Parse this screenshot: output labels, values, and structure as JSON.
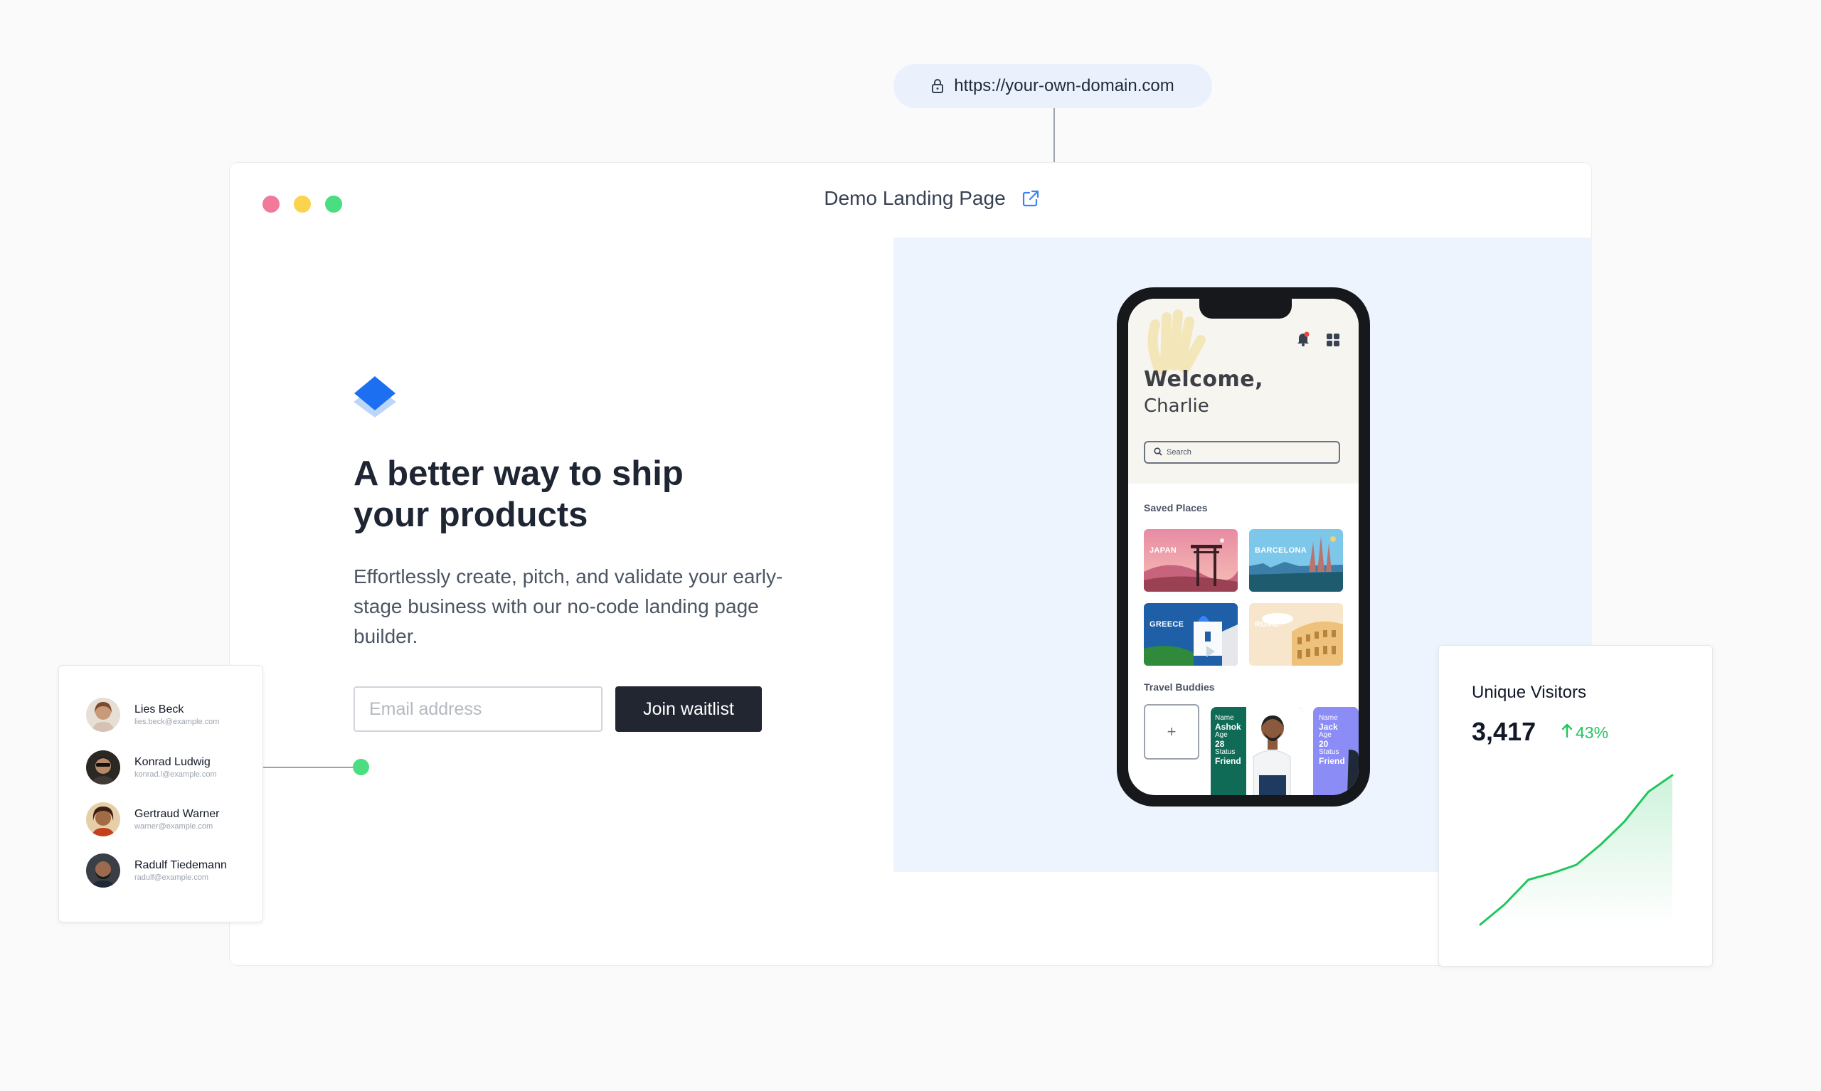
{
  "url_bar": {
    "url": "https://your-own-domain.com"
  },
  "window": {
    "title": "Demo Landing Page",
    "traffic_colors": [
      "#f2799a",
      "#fcd34d",
      "#4ade80"
    ]
  },
  "hero": {
    "headline_line1": "A better way to ship",
    "headline_line2": "your products",
    "subtext": "Effortlessly create, pitch, and validate your early-stage business with our no-code landing page builder.",
    "email_placeholder": "Email address",
    "button_label": "Join waitlist",
    "accent": "#1d6ff2"
  },
  "phone": {
    "welcome": "Welcome,",
    "name": "Charlie",
    "search_placeholder": "Search",
    "saved_places_label": "Saved Places",
    "places": [
      "JAPAN",
      "BARCELONA",
      "GREECE",
      "ROME"
    ],
    "travel_buddies_label": "Travel Buddies",
    "add_label": "+",
    "buddies": [
      {
        "name_label": "Name",
        "name": "Ashok",
        "age_label": "Age",
        "age": "28",
        "status_label": "Status",
        "status": "Friend"
      },
      {
        "name_label": "Name",
        "name": "Jack",
        "age_label": "Age",
        "age": "20",
        "status_label": "Status",
        "status": "Friend"
      }
    ]
  },
  "users": [
    {
      "name": "Lies Beck",
      "email": "lies.beck@example.com"
    },
    {
      "name": "Konrad Ludwig",
      "email": "konrad.l@example.com"
    },
    {
      "name": "Gertraud Warner",
      "email": "warner@example.com"
    },
    {
      "name": "Radulf Tiedemann",
      "email": "radulf@example.com"
    }
  ],
  "visitors": {
    "title": "Unique Visitors",
    "value": "3,417",
    "change": "43%",
    "trend": "up",
    "trend_color": "#22c55e",
    "chart_data": {
      "type": "area",
      "values": [
        0,
        12,
        27,
        31,
        36,
        48,
        62,
        80,
        90
      ]
    }
  }
}
